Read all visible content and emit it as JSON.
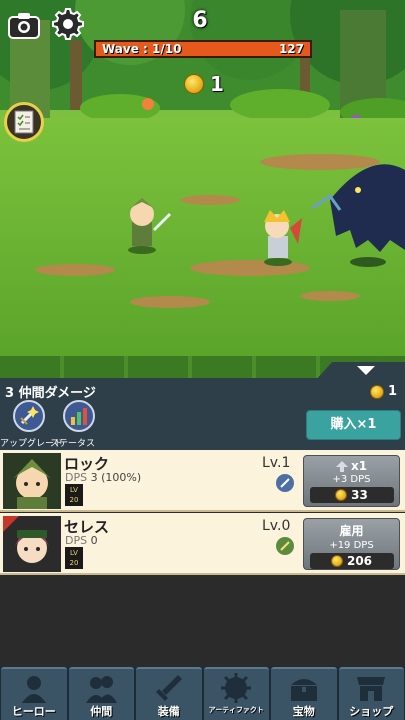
{
  "hud": {
    "timer": "6",
    "wave_label": "Wave : 1/10",
    "enemy_hp": "127",
    "coins": "1"
  },
  "party": {
    "title": "3 仲間ダメージ",
    "coins": "1",
    "upgrade_label": "アップグレード",
    "status_label": "ステータス",
    "buy_label": "購入×1"
  },
  "heroes": [
    {
      "name": "ロック",
      "dps_label": "DPS",
      "dps_value": "3 (100%)",
      "level": "Lv.1",
      "lv_tag": "LV 20",
      "action_title": "x1",
      "action_dps": "+3 DPS",
      "cost": "33"
    },
    {
      "name": "セレス",
      "dps_label": "DPS",
      "dps_value": "0",
      "level": "Lv.0",
      "lv_tag": "LV 20",
      "action_title": "雇用",
      "action_dps": "+19 DPS",
      "cost": "206"
    }
  ],
  "nav": [
    {
      "label": "ヒーロー",
      "icon": "hero-icon"
    },
    {
      "label": "仲間",
      "icon": "companions-icon"
    },
    {
      "label": "装備",
      "icon": "sword-icon"
    },
    {
      "label": "アーティファクト",
      "icon": "artifact-icon"
    },
    {
      "label": "宝物",
      "icon": "treasure-icon"
    },
    {
      "label": "ショップ",
      "icon": "shop-icon"
    }
  ]
}
